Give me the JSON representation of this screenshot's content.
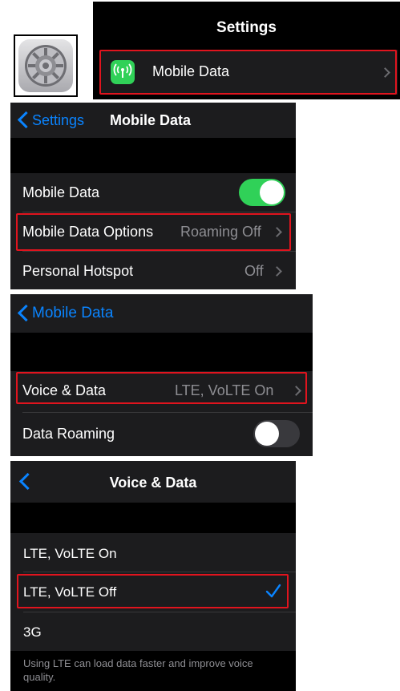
{
  "settings_icon": {
    "icon": "gear-icon"
  },
  "panel1": {
    "title": "Settings",
    "row_label": "Mobile Data",
    "row_icon": "antenna-icon",
    "colors": {
      "bg": "#000000",
      "row_bg": "#1c1c1e",
      "icon_green": "#30d158"
    }
  },
  "panel2": {
    "back_label": "Settings",
    "title": "Mobile Data",
    "rows": [
      {
        "label": "Mobile Data",
        "toggle_on": true
      },
      {
        "label": "Mobile Data Options",
        "value": "Roaming Off"
      },
      {
        "label": "Personal Hotspot",
        "value": "Off"
      }
    ]
  },
  "panel3": {
    "back_label": "Mobile Data",
    "rows": [
      {
        "label": "Voice & Data",
        "value": "LTE, VoLTE On"
      },
      {
        "label": "Data Roaming",
        "toggle_on": false
      }
    ]
  },
  "panel4": {
    "title": "Voice & Data",
    "options": [
      {
        "label": "LTE, VoLTE On",
        "checked": false
      },
      {
        "label": "LTE, VoLTE Off",
        "checked": true
      },
      {
        "label": "3G",
        "checked": false
      }
    ],
    "footer": "Using LTE can load data faster and improve voice quality."
  },
  "colors": {
    "highlight": "#e0141e",
    "accent_blue": "#0a84ff",
    "toggle_green": "#30d158",
    "toggle_off": "#39393d",
    "secondary_text": "#8e8e93"
  }
}
